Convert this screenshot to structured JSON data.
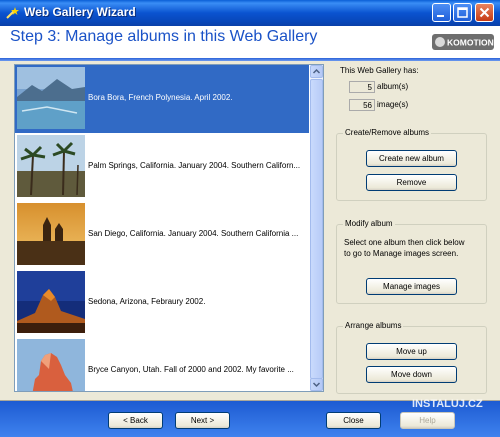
{
  "window": {
    "title": "Web Gallery Wizard"
  },
  "header": {
    "step_title": "Step 3: Manage albums in this Web Gallery",
    "logo_text": "KOMOTION"
  },
  "albums": [
    {
      "caption": "Bora Bora, French Polynesia. April 2002.",
      "selected": true
    },
    {
      "caption": "Palm Springs, California. January 2004. Southern Californ...",
      "selected": false
    },
    {
      "caption": "San Diego, California. January 2004. Southern California ...",
      "selected": false
    },
    {
      "caption": "Sedona, Arizona, Febraury 2002.",
      "selected": false
    },
    {
      "caption": "Bryce Canyon, Utah. Fall of 2000 and 2002. My favorite ...",
      "selected": false
    }
  ],
  "stats": {
    "heading": "This Web Gallery has:",
    "albums_count": "5",
    "albums_label": "album(s)",
    "images_count": "56",
    "images_label": "image(s)"
  },
  "create_remove": {
    "label": "Create/Remove albums",
    "create_button": "Create new album",
    "remove_button": "Remove"
  },
  "modify": {
    "label": "Modify album",
    "description_line1": "Select one album then click below",
    "description_line2": "to go to Manage images screen.",
    "manage_button": "Manage images"
  },
  "arrange": {
    "label": "Arrange albums",
    "move_up_button": "Move up",
    "move_down_button": "Move down"
  },
  "footer": {
    "back_button": "< Back",
    "next_button": "Next >",
    "close_button": "Close",
    "help_button": "Help"
  },
  "watermark": "INSTALUJ.CZ"
}
